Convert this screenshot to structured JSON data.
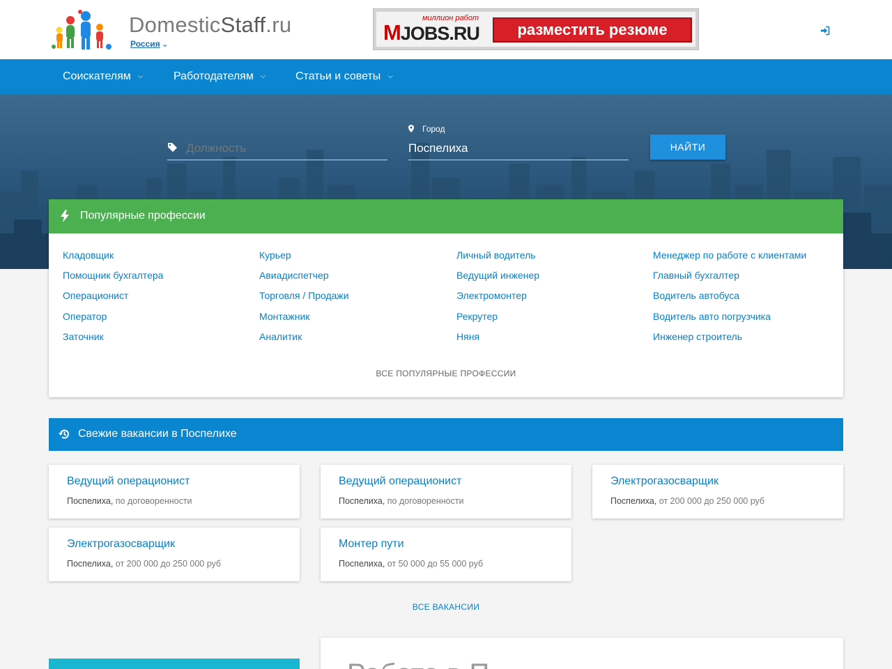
{
  "header": {
    "brand_light": "Domestic",
    "brand_bold": "Staff",
    "brand_tld": ".ru",
    "region": "Россия",
    "banner": {
      "logo_m": "M",
      "logo_rest": "JOBS.RU",
      "tagline": "миллион работ",
      "button": "разместить резюме"
    },
    "login_icon": "sign-in-icon"
  },
  "nav": {
    "items": [
      {
        "label": "Соискателям"
      },
      {
        "label": "Работодателям"
      },
      {
        "label": "Статьи и советы"
      }
    ]
  },
  "search": {
    "position_placeholder": "Должность",
    "city_label": "Город",
    "city_value": "Поспелиха",
    "button": "НАЙТИ"
  },
  "popular": {
    "title": "Популярные профессии",
    "columns": [
      [
        "Кладовщик",
        "Помощник бухгалтера",
        "Операционист",
        "Оператор",
        "Заточник"
      ],
      [
        "Курьер",
        "Авиадиспетчер",
        "Торговля / Продажи",
        "Монтажник",
        "Аналитик"
      ],
      [
        "Личный водитель",
        "Ведущий инженер",
        "Электромонтер",
        "Рекрутер",
        "Няня"
      ],
      [
        "Менеджер по работе с клиентами",
        "Главный бухгалтер",
        "Водитель автобуса",
        "Водитель авто погрузчика",
        "Инженер строитель"
      ]
    ],
    "all_link": "ВСЕ ПОПУЛЯРНЫЕ ПРОФЕССИИ"
  },
  "fresh": {
    "title": "Свежие вакансии в Поспелихе",
    "jobs": [
      {
        "title": "Ведущий операционист",
        "city": "Поспелиха,",
        "salary": " по договоренности"
      },
      {
        "title": "Ведущий операционист",
        "city": "Поспелиха,",
        "salary": " по договоренности"
      },
      {
        "title": "Электрогазосварщик",
        "city": "Поспелиха,",
        "salary": " от 200 000 до 250 000 руб"
      },
      {
        "title": "Электрогазосварщик",
        "city": "Поспелиха,",
        "salary": " от 200 000 до 250 000 руб"
      },
      {
        "title": "Монтер пути",
        "city": "Поспелиха,",
        "salary": " от 50 000 до 55 000 руб"
      }
    ],
    "all_link": "ВСЕ ВАКАНСИИ"
  },
  "bottom": {
    "partial_heading": "Работа в П"
  },
  "colors": {
    "nav_blue": "#0a85d0",
    "popular_green": "#4caf50",
    "link_blue": "#0a7fc5",
    "banner_red": "#d61f26"
  }
}
